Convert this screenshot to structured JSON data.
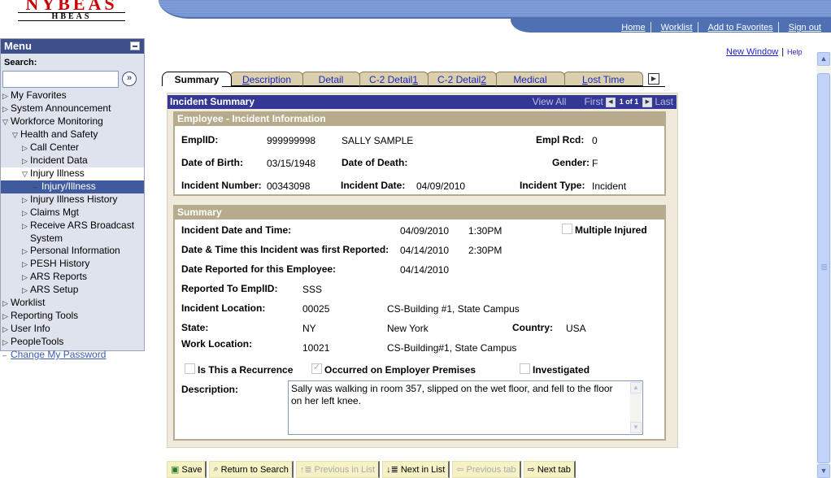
{
  "logo": {
    "title": "NYBEAS",
    "subtitle": "HBEAS"
  },
  "topnav": {
    "links": [
      "Home",
      "Worklist",
      "Add to Favorites",
      "Sign out"
    ],
    "new_window": "New Window",
    "help": "Help"
  },
  "menu": {
    "title": "Menu",
    "search_label": "Search:",
    "search_value": "",
    "go_glyph": "»",
    "items": [
      {
        "label": "My Favorites",
        "arrow": "▷",
        "level": 0
      },
      {
        "label": "System Announcement",
        "arrow": "▷",
        "level": 0
      },
      {
        "label": "Workforce Monitoring",
        "arrow": "▽",
        "level": 0
      },
      {
        "label": "Health and Safety",
        "arrow": "▽",
        "level": 1
      },
      {
        "label": "Call Center",
        "arrow": "▷",
        "level": 2
      },
      {
        "label": "Incident Data",
        "arrow": "▷",
        "level": 2
      },
      {
        "label": "Injury Illness",
        "arrow": "▽",
        "level": 2
      },
      {
        "label": "Injury/Illness",
        "arrow": "–",
        "level": 3
      },
      {
        "label": "Injury Illness History",
        "arrow": "▷",
        "level": 2
      },
      {
        "label": "Claims Mgt",
        "arrow": "▷",
        "level": 2
      },
      {
        "label": "Receive ARS Broadcast",
        "arrow": "▷",
        "level": 2
      },
      {
        "label": "System",
        "arrow": "",
        "level": 2
      },
      {
        "label": "Personal Information",
        "arrow": "▷",
        "level": 2
      },
      {
        "label": "PESH History",
        "arrow": "▷",
        "level": 2
      },
      {
        "label": "ARS Reports",
        "arrow": "▷",
        "level": 2
      },
      {
        "label": "ARS Setup",
        "arrow": "▷",
        "level": 2
      },
      {
        "label": "Worklist",
        "arrow": "▷",
        "level": 0
      },
      {
        "label": "Reporting Tools",
        "arrow": "▷",
        "level": 0
      },
      {
        "label": "User Info",
        "arrow": "▷",
        "level": 0
      },
      {
        "label": "PeopleTools",
        "arrow": "▷",
        "level": 0
      },
      {
        "label": "Change My Password",
        "arrow": "–",
        "level": 0
      }
    ]
  },
  "tabs": [
    {
      "pre": "",
      "u": "",
      "post": "Summary",
      "active": true
    },
    {
      "pre": "",
      "u": "D",
      "post": "escription",
      "active": false
    },
    {
      "pre": "Detail",
      "u": "",
      "post": "",
      "active": false
    },
    {
      "pre": "C-2 Detail",
      "u": "1",
      "post": "",
      "active": false
    },
    {
      "pre": "C-2 Detail",
      "u": "2",
      "post": "",
      "active": false
    },
    {
      "pre": "Medical",
      "u": "",
      "post": "",
      "active": false
    },
    {
      "pre": "",
      "u": "L",
      "post": "ost Time",
      "active": false
    }
  ],
  "incident_summary": {
    "title": "Incident Summary",
    "view_all": "View All",
    "first": "First",
    "count": "1 of 1",
    "last": "Last"
  },
  "employee_section": {
    "title": "Employee - Incident Information",
    "emplid_label": "EmplID:",
    "emplid": "999999998",
    "name": "SALLY SAMPLE",
    "empl_rcd_label": "Empl Rcd:",
    "empl_rcd": "0",
    "dob_label": "Date of Birth:",
    "dob": "03/15/1948",
    "dod_label": "Date of Death:",
    "dod": "",
    "gender_label": "Gender:",
    "gender": "F",
    "incident_number_label": "Incident Number:",
    "incident_number": "00343098",
    "incident_date_label": "Incident Date:",
    "incident_date": "04/09/2010",
    "incident_type_label": "Incident Type:",
    "incident_type": "Incident"
  },
  "summary_section": {
    "title": "Summary",
    "incident_dt_label": "Incident Date and Time:",
    "incident_date": "04/09/2010",
    "incident_time": "1:30PM",
    "multiple_injured_label": "Multiple Injured",
    "multiple_injured": false,
    "first_reported_label": "Date & Time this Incident was first Reported:",
    "first_reported_date": "04/14/2010",
    "first_reported_time": "2:30PM",
    "date_reported_label": "Date Reported for this Employee:",
    "date_reported": "04/14/2010",
    "reported_to_label": "Reported To EmplID:",
    "reported_to": "SSS",
    "incident_location_label": "Incident Location:",
    "incident_location_code": "00025",
    "incident_location_name": "CS-Building #1, State Campus",
    "state_label": "State:",
    "state_code": "NY",
    "state_name": "New York",
    "country_label": "Country:",
    "country": "USA",
    "work_location_label": "Work Location:",
    "work_location_code": "10021",
    "work_location_name": "CS-Building#1, State Campus",
    "recurrence_label": "Is This a Recurrence",
    "recurrence": false,
    "premises_label": "Occurred on Employer Premises",
    "premises": true,
    "investigated_label": "Investigated",
    "investigated": false,
    "description_label": "Description:",
    "description": "Sally was walking in room 357, slipped on the wet floor, and fell to the floor on her left knee."
  },
  "toolbar": {
    "save": "Save",
    "return_to_search": "Return to Search",
    "previous_in_list": "Previous in List",
    "next_in_list": "Next in List",
    "previous_tab": "Previous tab",
    "next_tab": "Next tab"
  }
}
